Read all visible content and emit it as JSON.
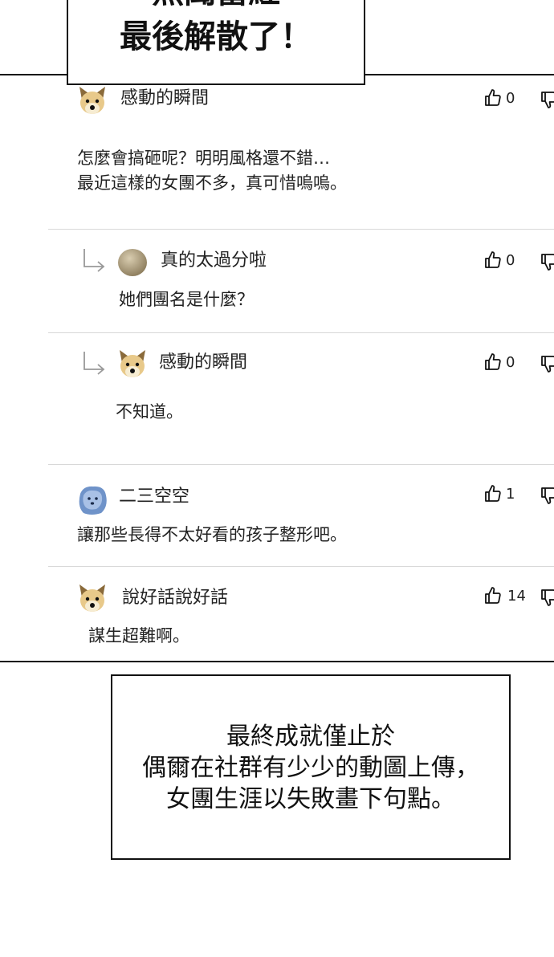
{
  "top_caption": {
    "line1": "無聞當紅",
    "line2": "最後解散了！"
  },
  "comments": [
    {
      "username": "感動的瞬間",
      "avatar": "dog-avatar",
      "text": "怎麼會搞砸呢？明明風格還不錯…\n最近這樣的女團不多，真可惜嗚嗚。",
      "likes": "0"
    },
    {
      "username": "真的太過分啦",
      "avatar": "round-avatar",
      "text": "她們團名是什麼？",
      "likes": "0",
      "reply": true
    },
    {
      "username": "感動的瞬間",
      "avatar": "dog-avatar",
      "text": "不知道。",
      "likes": "0",
      "reply": true
    },
    {
      "username": "二三空空",
      "avatar": "blue-avatar",
      "text": "讓那些長得不太好看的孩子整形吧。",
      "likes": "1"
    },
    {
      "username": "說好話說好話",
      "avatar": "dog-avatar",
      "text": "謀生超難啊。",
      "likes": "14"
    }
  ],
  "bottom_caption": {
    "line1": "最終成就僅止於",
    "line2": "偶爾在社群有少少的動圖上傳，",
    "line3": "女團生涯以失敗畫下句點。"
  },
  "colors": {
    "border": "#111111",
    "divider": "#d8d8d8",
    "text": "#222222"
  }
}
